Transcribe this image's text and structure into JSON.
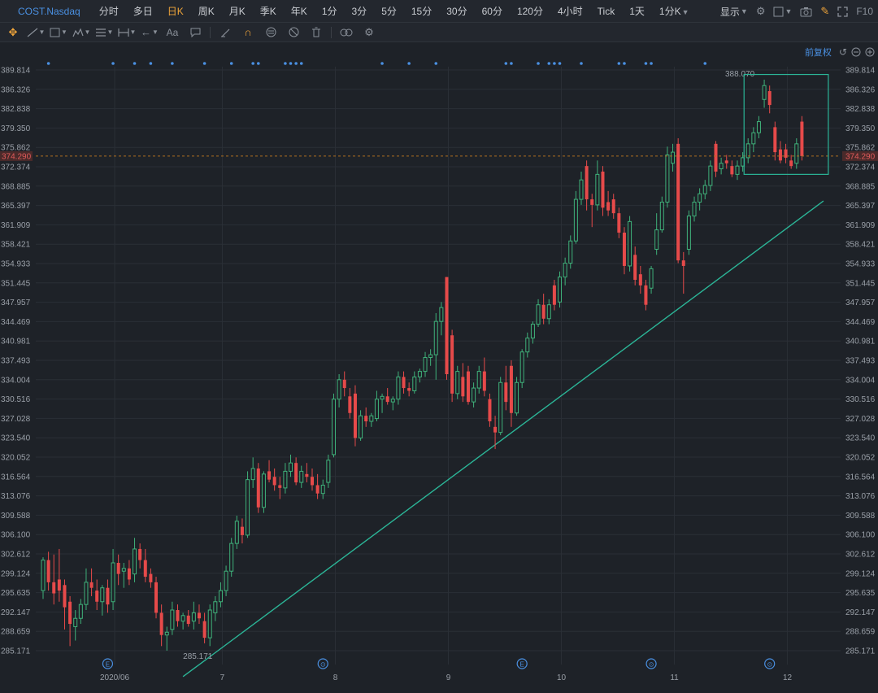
{
  "header": {
    "symbol": "COST.Nasdaq",
    "periods": [
      {
        "label": "分时",
        "active": false
      },
      {
        "label": "多日",
        "active": false
      },
      {
        "label": "日K",
        "active": true
      },
      {
        "label": "周K",
        "active": false
      },
      {
        "label": "月K",
        "active": false
      },
      {
        "label": "季K",
        "active": false
      },
      {
        "label": "年K",
        "active": false
      },
      {
        "label": "1分",
        "active": false
      },
      {
        "label": "3分",
        "active": false
      },
      {
        "label": "5分",
        "active": false
      },
      {
        "label": "15分",
        "active": false
      },
      {
        "label": "30分",
        "active": false
      },
      {
        "label": "60分",
        "active": false
      },
      {
        "label": "120分",
        "active": false
      },
      {
        "label": "4小时",
        "active": false
      },
      {
        "label": "Tick",
        "active": false
      },
      {
        "label": "1天",
        "active": false
      }
    ],
    "extra_period": "1分K",
    "display_label": "显示",
    "f10_label": "F10"
  },
  "toolbar": {
    "text_tool_label": "Aa",
    "icons": [
      "move-icon",
      "trend-line-icon",
      "rect-icon",
      "pattern-icon",
      "parallel-icon",
      "measure-icon",
      "arrow-icon",
      "text-icon",
      "comment-icon",
      "pen-icon",
      "magnet-icon",
      "lock-icon",
      "hide-icon",
      "trash-icon",
      "link-icon",
      "settings-icon"
    ]
  },
  "chart_area": {
    "rights_label": "前复权"
  },
  "colors": {
    "up": "#3fb17a",
    "down": "#e64a4a",
    "trend": "#2bb597",
    "current_price_line": "#b07020",
    "current_price_tag_bg": "#4a2a2a",
    "marker": "#4a90e2",
    "background": "#1e2228"
  },
  "chart_data": {
    "type": "candlestick",
    "y_ticks": [
      "389.814",
      "386.326",
      "382.838",
      "379.350",
      "375.862",
      "372.374",
      "368.885",
      "365.397",
      "361.909",
      "358.421",
      "354.933",
      "351.445",
      "347.957",
      "344.469",
      "340.981",
      "337.493",
      "334.004",
      "330.516",
      "327.028",
      "323.540",
      "320.052",
      "316.564",
      "313.076",
      "309.588",
      "306.100",
      "302.612",
      "299.124",
      "295.635",
      "292.147",
      "288.659",
      "285.171"
    ],
    "ylim": [
      285.171,
      389.814
    ],
    "x_labels": [
      {
        "label": "2020/06",
        "index": 13
      },
      {
        "label": "7",
        "index": 33
      },
      {
        "label": "8",
        "index": 54
      },
      {
        "label": "9",
        "index": 75
      },
      {
        "label": "10",
        "index": 96
      },
      {
        "label": "11",
        "index": 117
      },
      {
        "label": "12",
        "index": 138
      }
    ],
    "current_price": "374.290",
    "high_label": "388.070",
    "low_label": "285.171",
    "event_markers": [
      {
        "label": "E",
        "index": 12
      },
      {
        "label": "⊙",
        "index": 52
      },
      {
        "label": "E",
        "index": 89
      },
      {
        "label": "⊙",
        "index": 113
      },
      {
        "label": "⊙",
        "index": 135
      }
    ],
    "dots": [
      1,
      13,
      17,
      20,
      24,
      30,
      35,
      39,
      40,
      45,
      46,
      47,
      48,
      63,
      68,
      73,
      86,
      87,
      92,
      94,
      95,
      96,
      100,
      107,
      108,
      112,
      113,
      123
    ],
    "trend_line": {
      "start": {
        "index": 26,
        "price": 280.5
      },
      "end": {
        "index": 145,
        "price": 366.2
      }
    },
    "candles": [
      {
        "o": 296.0,
        "h": 302.0,
        "l": 294.5,
        "c": 301.5
      },
      {
        "o": 301.5,
        "h": 303.0,
        "l": 296.0,
        "c": 297.5
      },
      {
        "o": 297.5,
        "h": 302.5,
        "l": 293.5,
        "c": 295.5
      },
      {
        "o": 298.0,
        "h": 303.5,
        "l": 294.0,
        "c": 296.0
      },
      {
        "o": 297.0,
        "h": 298.0,
        "l": 289.0,
        "c": 293.0
      },
      {
        "o": 294.0,
        "h": 295.0,
        "l": 286.0,
        "c": 290.0
      },
      {
        "o": 289.5,
        "h": 292.5,
        "l": 287.0,
        "c": 291.0
      },
      {
        "o": 291.0,
        "h": 294.5,
        "l": 290.0,
        "c": 293.5
      },
      {
        "o": 293.5,
        "h": 300.0,
        "l": 292.5,
        "c": 297.5
      },
      {
        "o": 297.5,
        "h": 300.0,
        "l": 295.0,
        "c": 296.5
      },
      {
        "o": 296.0,
        "h": 298.0,
        "l": 292.5,
        "c": 294.0
      },
      {
        "o": 294.0,
        "h": 297.0,
        "l": 291.5,
        "c": 296.5
      },
      {
        "o": 296.5,
        "h": 298.0,
        "l": 292.0,
        "c": 293.5
      },
      {
        "o": 294.0,
        "h": 303.5,
        "l": 292.5,
        "c": 301.0
      },
      {
        "o": 301.0,
        "h": 302.5,
        "l": 297.0,
        "c": 299.0
      },
      {
        "o": 299.5,
        "h": 301.0,
        "l": 296.5,
        "c": 300.0
      },
      {
        "o": 300.0,
        "h": 301.5,
        "l": 297.0,
        "c": 298.0
      },
      {
        "o": 299.0,
        "h": 305.5,
        "l": 297.5,
        "c": 303.5
      },
      {
        "o": 303.5,
        "h": 304.5,
        "l": 300.0,
        "c": 301.5
      },
      {
        "o": 301.5,
        "h": 303.5,
        "l": 297.5,
        "c": 298.5
      },
      {
        "o": 299.0,
        "h": 300.0,
        "l": 296.5,
        "c": 297.5
      },
      {
        "o": 297.5,
        "h": 298.5,
        "l": 291.0,
        "c": 292.0
      },
      {
        "o": 292.0,
        "h": 293.5,
        "l": 286.0,
        "c": 288.0
      },
      {
        "o": 288.0,
        "h": 289.5,
        "l": 285.171,
        "c": 288.5
      },
      {
        "o": 289.0,
        "h": 294.0,
        "l": 288.0,
        "c": 292.5
      },
      {
        "o": 292.5,
        "h": 293.5,
        "l": 289.5,
        "c": 290.5
      },
      {
        "o": 290.5,
        "h": 292.0,
        "l": 289.0,
        "c": 291.5
      },
      {
        "o": 291.5,
        "h": 292.5,
        "l": 289.5,
        "c": 290.0
      },
      {
        "o": 290.5,
        "h": 294.0,
        "l": 289.0,
        "c": 292.0
      },
      {
        "o": 292.0,
        "h": 293.5,
        "l": 290.0,
        "c": 291.0
      },
      {
        "o": 290.5,
        "h": 292.0,
        "l": 286.5,
        "c": 287.5
      },
      {
        "o": 287.5,
        "h": 293.5,
        "l": 286.0,
        "c": 292.5
      },
      {
        "o": 292.0,
        "h": 295.0,
        "l": 290.5,
        "c": 294.0
      },
      {
        "o": 294.0,
        "h": 297.5,
        "l": 293.0,
        "c": 296.0
      },
      {
        "o": 296.0,
        "h": 300.5,
        "l": 295.0,
        "c": 299.5
      },
      {
        "o": 299.5,
        "h": 305.5,
        "l": 298.5,
        "c": 304.5
      },
      {
        "o": 304.5,
        "h": 309.5,
        "l": 303.5,
        "c": 308.5
      },
      {
        "o": 307.5,
        "h": 309.0,
        "l": 304.5,
        "c": 306.0
      },
      {
        "o": 306.0,
        "h": 317.5,
        "l": 305.5,
        "c": 316.0
      },
      {
        "o": 316.0,
        "h": 320.0,
        "l": 314.5,
        "c": 318.0
      },
      {
        "o": 318.0,
        "h": 319.0,
        "l": 310.0,
        "c": 311.0
      },
      {
        "o": 311.0,
        "h": 317.5,
        "l": 310.0,
        "c": 317.0
      },
      {
        "o": 317.5,
        "h": 319.5,
        "l": 315.5,
        "c": 316.0
      },
      {
        "o": 316.5,
        "h": 318.0,
        "l": 314.0,
        "c": 315.0
      },
      {
        "o": 315.0,
        "h": 316.5,
        "l": 312.5,
        "c": 314.5
      },
      {
        "o": 314.5,
        "h": 319.0,
        "l": 313.5,
        "c": 317.5
      },
      {
        "o": 317.5,
        "h": 320.5,
        "l": 316.5,
        "c": 319.0
      },
      {
        "o": 319.0,
        "h": 320.0,
        "l": 315.0,
        "c": 315.5
      },
      {
        "o": 315.5,
        "h": 318.5,
        "l": 314.5,
        "c": 317.5
      },
      {
        "o": 317.0,
        "h": 319.0,
        "l": 315.5,
        "c": 316.5
      },
      {
        "o": 316.5,
        "h": 318.0,
        "l": 314.0,
        "c": 315.0
      },
      {
        "o": 315.0,
        "h": 317.0,
        "l": 312.5,
        "c": 313.5
      },
      {
        "o": 313.5,
        "h": 316.0,
        "l": 312.5,
        "c": 315.0
      },
      {
        "o": 315.5,
        "h": 320.5,
        "l": 314.5,
        "c": 319.5
      },
      {
        "o": 320.5,
        "h": 331.5,
        "l": 320.0,
        "c": 330.5
      },
      {
        "o": 330.5,
        "h": 335.0,
        "l": 329.0,
        "c": 334.0
      },
      {
        "o": 334.0,
        "h": 335.5,
        "l": 331.0,
        "c": 332.5
      },
      {
        "o": 331.0,
        "h": 332.5,
        "l": 327.0,
        "c": 328.0
      },
      {
        "o": 331.5,
        "h": 333.0,
        "l": 322.0,
        "c": 323.5
      },
      {
        "o": 323.5,
        "h": 328.5,
        "l": 323.0,
        "c": 327.5
      },
      {
        "o": 327.5,
        "h": 329.0,
        "l": 325.5,
        "c": 326.5
      },
      {
        "o": 326.5,
        "h": 328.0,
        "l": 325.5,
        "c": 327.5
      },
      {
        "o": 327.0,
        "h": 332.0,
        "l": 326.5,
        "c": 330.5
      },
      {
        "o": 330.5,
        "h": 331.5,
        "l": 328.0,
        "c": 331.0
      },
      {
        "o": 331.0,
        "h": 332.5,
        "l": 329.5,
        "c": 330.0
      },
      {
        "o": 330.0,
        "h": 331.0,
        "l": 328.5,
        "c": 330.5
      },
      {
        "o": 330.5,
        "h": 335.5,
        "l": 329.5,
        "c": 334.5
      },
      {
        "o": 334.5,
        "h": 335.5,
        "l": 331.5,
        "c": 332.5
      },
      {
        "o": 332.5,
        "h": 333.5,
        "l": 331.0,
        "c": 332.0
      },
      {
        "o": 332.0,
        "h": 335.5,
        "l": 331.5,
        "c": 334.5
      },
      {
        "o": 334.5,
        "h": 336.0,
        "l": 333.5,
        "c": 335.5
      },
      {
        "o": 335.5,
        "h": 339.0,
        "l": 334.5,
        "c": 338.0
      },
      {
        "o": 338.0,
        "h": 339.5,
        "l": 336.5,
        "c": 338.5
      },
      {
        "o": 338.5,
        "h": 346.0,
        "l": 334.0,
        "c": 344.5
      },
      {
        "o": 344.5,
        "h": 348.0,
        "l": 342.0,
        "c": 347.0
      },
      {
        "o": 352.5,
        "h": 352.5,
        "l": 334.0,
        "c": 335.0
      },
      {
        "o": 342.0,
        "h": 343.0,
        "l": 330.0,
        "c": 331.5
      },
      {
        "o": 331.5,
        "h": 336.5,
        "l": 330.5,
        "c": 335.5
      },
      {
        "o": 334.5,
        "h": 337.0,
        "l": 330.0,
        "c": 331.0
      },
      {
        "o": 335.5,
        "h": 336.5,
        "l": 329.5,
        "c": 330.0
      },
      {
        "o": 330.0,
        "h": 333.5,
        "l": 329.0,
        "c": 332.5
      },
      {
        "o": 332.5,
        "h": 336.5,
        "l": 331.5,
        "c": 335.5
      },
      {
        "o": 335.5,
        "h": 338.0,
        "l": 331.0,
        "c": 332.0
      },
      {
        "o": 330.5,
        "h": 331.5,
        "l": 325.5,
        "c": 326.5
      },
      {
        "o": 325.5,
        "h": 327.5,
        "l": 321.5,
        "c": 324.5
      },
      {
        "o": 324.5,
        "h": 334.5,
        "l": 324.0,
        "c": 333.5
      },
      {
        "o": 333.5,
        "h": 336.5,
        "l": 328.5,
        "c": 330.0
      },
      {
        "o": 336.5,
        "h": 337.5,
        "l": 325.5,
        "c": 328.0
      },
      {
        "o": 328.0,
        "h": 334.5,
        "l": 327.5,
        "c": 333.5
      },
      {
        "o": 333.5,
        "h": 339.5,
        "l": 332.5,
        "c": 339.0
      },
      {
        "o": 339.0,
        "h": 342.5,
        "l": 338.0,
        "c": 341.5
      },
      {
        "o": 341.5,
        "h": 344.5,
        "l": 340.5,
        "c": 344.0
      },
      {
        "o": 344.0,
        "h": 348.5,
        "l": 343.5,
        "c": 347.5
      },
      {
        "o": 347.5,
        "h": 349.5,
        "l": 344.0,
        "c": 345.0
      },
      {
        "o": 345.0,
        "h": 348.5,
        "l": 344.0,
        "c": 347.5
      },
      {
        "o": 351.0,
        "h": 352.0,
        "l": 346.5,
        "c": 347.5
      },
      {
        "o": 348.0,
        "h": 353.5,
        "l": 347.0,
        "c": 352.5
      },
      {
        "o": 352.5,
        "h": 356.0,
        "l": 351.0,
        "c": 355.0
      },
      {
        "o": 355.0,
        "h": 360.0,
        "l": 354.0,
        "c": 359.0
      },
      {
        "o": 359.0,
        "h": 368.0,
        "l": 358.5,
        "c": 366.5
      },
      {
        "o": 366.5,
        "h": 371.5,
        "l": 365.5,
        "c": 370.0
      },
      {
        "o": 372.5,
        "h": 373.5,
        "l": 364.5,
        "c": 366.5
      },
      {
        "o": 366.5,
        "h": 367.5,
        "l": 361.5,
        "c": 365.5
      },
      {
        "o": 365.5,
        "h": 373.5,
        "l": 364.5,
        "c": 371.0
      },
      {
        "o": 371.5,
        "h": 372.5,
        "l": 363.5,
        "c": 365.0
      },
      {
        "o": 366.0,
        "h": 368.0,
        "l": 363.5,
        "c": 364.5
      },
      {
        "o": 366.5,
        "h": 367.5,
        "l": 363.0,
        "c": 364.0
      },
      {
        "o": 364.0,
        "h": 365.0,
        "l": 359.5,
        "c": 360.5
      },
      {
        "o": 360.5,
        "h": 361.5,
        "l": 353.0,
        "c": 354.5
      },
      {
        "o": 354.5,
        "h": 363.5,
        "l": 353.5,
        "c": 362.5
      },
      {
        "o": 356.5,
        "h": 358.0,
        "l": 351.0,
        "c": 352.0
      },
      {
        "o": 353.0,
        "h": 354.5,
        "l": 349.5,
        "c": 351.0
      },
      {
        "o": 351.0,
        "h": 352.0,
        "l": 346.5,
        "c": 347.5
      },
      {
        "o": 350.5,
        "h": 354.5,
        "l": 349.5,
        "c": 354.0
      },
      {
        "o": 357.5,
        "h": 364.0,
        "l": 356.5,
        "c": 361.0
      },
      {
        "o": 361.0,
        "h": 367.0,
        "l": 360.5,
        "c": 366.0
      },
      {
        "o": 366.0,
        "h": 376.0,
        "l": 365.0,
        "c": 374.5
      },
      {
        "o": 373.0,
        "h": 376.5,
        "l": 371.5,
        "c": 375.0
      },
      {
        "o": 376.5,
        "h": 377.5,
        "l": 355.0,
        "c": 355.5
      },
      {
        "o": 355.5,
        "h": 357.0,
        "l": 349.5,
        "c": 354.5
      },
      {
        "o": 357.5,
        "h": 364.5,
        "l": 356.5,
        "c": 363.5
      },
      {
        "o": 363.5,
        "h": 367.0,
        "l": 362.5,
        "c": 366.0
      },
      {
        "o": 366.0,
        "h": 368.5,
        "l": 364.5,
        "c": 367.5
      },
      {
        "o": 367.5,
        "h": 370.0,
        "l": 366.5,
        "c": 369.0
      },
      {
        "o": 369.0,
        "h": 373.5,
        "l": 368.0,
        "c": 372.5
      },
      {
        "o": 376.5,
        "h": 377.0,
        "l": 370.5,
        "c": 371.5
      },
      {
        "o": 372.0,
        "h": 374.0,
        "l": 371.0,
        "c": 373.0
      },
      {
        "o": 373.5,
        "h": 374.5,
        "l": 372.0,
        "c": 373.0
      },
      {
        "o": 372.5,
        "h": 373.5,
        "l": 370.5,
        "c": 371.0
      },
      {
        "o": 371.0,
        "h": 373.5,
        "l": 370.0,
        "c": 372.5
      },
      {
        "o": 372.5,
        "h": 375.0,
        "l": 371.5,
        "c": 374.0
      },
      {
        "o": 374.0,
        "h": 377.5,
        "l": 373.0,
        "c": 376.5
      },
      {
        "o": 376.5,
        "h": 379.5,
        "l": 375.0,
        "c": 378.5
      },
      {
        "o": 378.5,
        "h": 381.5,
        "l": 377.5,
        "c": 380.5
      },
      {
        "o": 384.5,
        "h": 388.07,
        "l": 383.0,
        "c": 387.0
      },
      {
        "o": 386.0,
        "h": 387.0,
        "l": 382.0,
        "c": 383.5
      },
      {
        "o": 379.5,
        "h": 380.5,
        "l": 373.5,
        "c": 375.0
      },
      {
        "o": 375.5,
        "h": 377.0,
        "l": 373.0,
        "c": 373.5
      },
      {
        "o": 375.5,
        "h": 376.5,
        "l": 373.0,
        "c": 374.0
      },
      {
        "o": 373.5,
        "h": 374.5,
        "l": 372.0,
        "c": 372.5
      },
      {
        "o": 373.0,
        "h": 377.5,
        "l": 372.0,
        "c": 376.5
      },
      {
        "o": 380.5,
        "h": 381.5,
        "l": 373.5,
        "c": 374.29
      }
    ]
  }
}
